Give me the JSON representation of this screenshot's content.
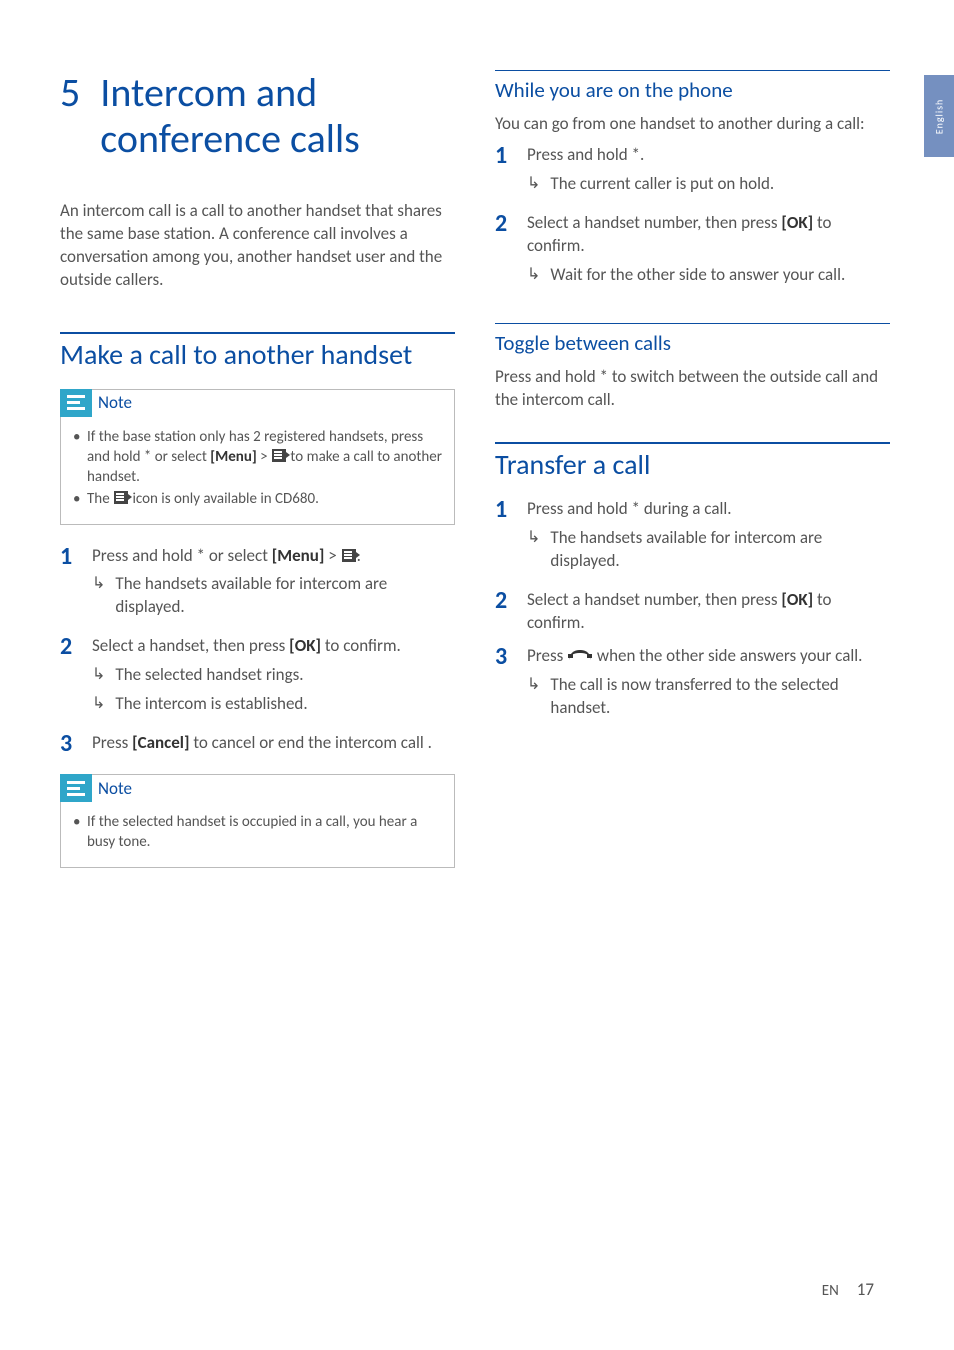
{
  "sideTab": "English",
  "chapter": {
    "num": "5",
    "title": "Intercom and conference calls"
  },
  "intro": "An intercom call is a call to another handset that shares the same base station. A conference call involves a conversation among you, another handset user and the outside callers.",
  "sec1": {
    "title": "Make a call to another handset",
    "noteLabel": "Note",
    "note1a": "If the base station only has 2 registered handsets, press and hold * or select ",
    "note1b_bold": "[Menu]",
    "note1c": " > ",
    "note1d": " to make a call to another handset.",
    "note2a": "The ",
    "note2b": " icon is only available in CD680.",
    "step1a": "Press and hold * or select ",
    "step1b_bold": "[Menu]",
    "step1c": " > ",
    "step1d": ".",
    "step1r": "The handsets available for intercom are displayed.",
    "step2a": "Select a handset, then press ",
    "step2b_bold": "[OK]",
    "step2c": " to confirm.",
    "step2r1": "The selected handset rings.",
    "step2r2": "The intercom is established.",
    "step3a": "Press ",
    "step3b_bold": "[Cancel]",
    "step3c": " to cancel or end the intercom call .",
    "note3": "If the selected handset is occupied in a call, you hear a busy tone."
  },
  "sec2": {
    "title": "While you are on the phone",
    "intro": "You can go from one handset to another during a call:",
    "step1": "Press and hold *.",
    "step1r": "The current caller is put on hold.",
    "step2a": "Select a handset number, then press ",
    "step2b_bold": "[OK]",
    "step2c": " to confirm.",
    "step2r": "Wait for the other side to answer your call."
  },
  "sec3": {
    "title": "Toggle between calls",
    "body": "Press and hold * to switch between the outside call and the intercom call."
  },
  "sec4": {
    "title": "Transfer a call",
    "step1": "Press and hold * during a call.",
    "step1r": "The handsets available for intercom are displayed.",
    "step2a": "Select a handset number, then press ",
    "step2b_bold": "[OK]",
    "step2c": " to confirm.",
    "step3a": "Press ",
    "step3b": " when the other side answers your call.",
    "step3r": "The call is now transferred to the selected handset."
  },
  "footer": {
    "lang": "EN",
    "page": "17"
  }
}
